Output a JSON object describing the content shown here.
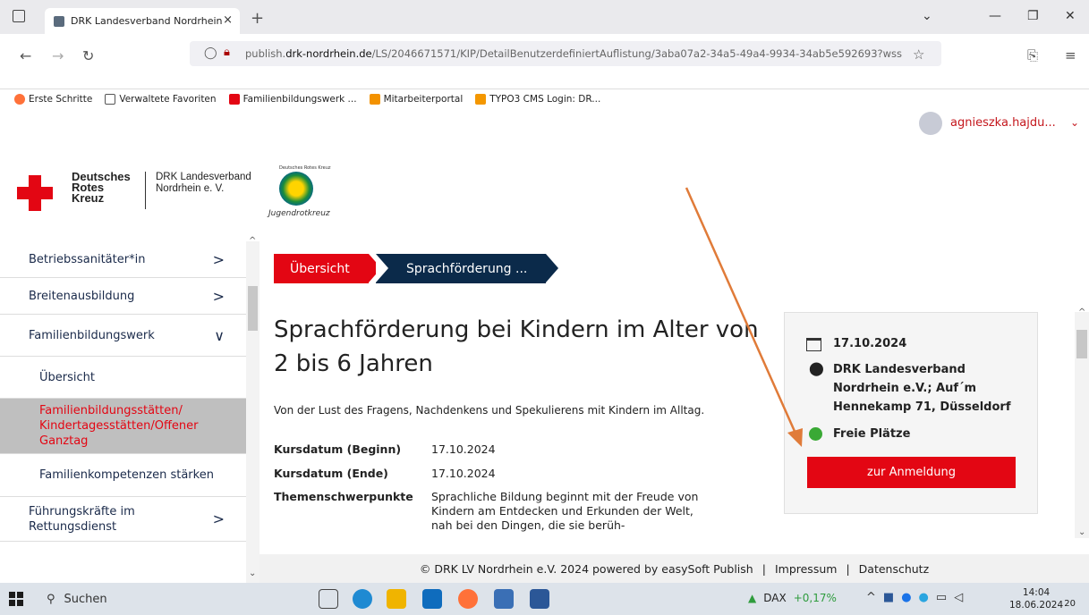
{
  "browser": {
    "tab_title": "DRK Landesverband Nordrhein",
    "tab_close": "×",
    "new_tab": "+",
    "url_domain_prefix": "publish.",
    "url_domain": "drk-nordrhein.de",
    "url_path": "/LS/2046671571/KIP/DetailBenutzerdefiniertAuflistung/3aba07a2-34a5-49a4-9934-34ab5e592693?wss",
    "bookmarks": [
      "Erste Schritte",
      "Verwaltete Favoriten",
      "Familienbildungswerk ...",
      "Mitarbeiterportal",
      "TYPO3 CMS Login: DR..."
    ]
  },
  "user": {
    "name": "agnieszka.hajdu..."
  },
  "logo": {
    "org_name": "Deutsches Rotes Kreuz",
    "org_line1": "Deutsches",
    "org_line2": "Rotes",
    "org_line3": "Kreuz",
    "branch_line1": "DRK Landesverband",
    "branch_line2": "Nordrhein e. V.",
    "jrk_top": "Deutsches Rotes Kreuz",
    "jrk_text": "Jugendrotkreuz"
  },
  "sidebar": {
    "items": [
      {
        "label": "Betriebssanitäter*in",
        "chevron": ">"
      },
      {
        "label": "Breitenausbildung",
        "chevron": ">"
      },
      {
        "label": "Familienbildungswerk",
        "chevron": "∨"
      },
      {
        "label": "Übersicht"
      },
      {
        "label": "Familienbildungsstätten/ Kindertagesstätten/Offener Ganztag"
      },
      {
        "label": "Familienkompetenzen stärken"
      },
      {
        "label": "Führungskräfte im Rettungsdienst",
        "chevron": ">"
      }
    ]
  },
  "breadcrumb": {
    "first": "Übersicht",
    "second": "Sprachförderung ..."
  },
  "course": {
    "title": "Sprachförderung bei Kindern im Alter von 2 bis 6 Jahren",
    "subtitle": "Von der Lust des Fragens, Nachdenkens und Spekulierens mit Kindern im Alltag.",
    "details": [
      {
        "key": "Kursdatum (Beginn)",
        "value": "17.10.2024"
      },
      {
        "key": "Kursdatum (Ende)",
        "value": "17.10.2024"
      },
      {
        "key": "Themenschwerpunkte",
        "value": "Sprachliche Bildung beginnt mit der Freude von Kindern am Entdecken und Erkunden der Welt, nah bei den Dingen, die sie berüh-"
      }
    ]
  },
  "infobox": {
    "date": "17.10.2024",
    "address": "DRK Landesverband Nordrhein e.V.; Auf´m Hennekamp 71, Düsseldorf",
    "availability": "Freie Plätze",
    "button": "zur Anmeldung"
  },
  "footer": {
    "copyright": "© DRK LV Nordrhein e.V. 2024 powered by easySoft Publish",
    "sep": "|",
    "impressum": "Impressum",
    "datenschutz": "Datenschutz"
  },
  "taskbar": {
    "search": "Suchen",
    "dax_label": "DAX",
    "dax_change": "+0,17%",
    "time": "14:04",
    "date": "18.06.2024",
    "notifications": "20"
  },
  "colors": {
    "drk_red": "#e30613",
    "navy": "#0b2a4a",
    "free_green": "#3aa935",
    "annotation_arrow": "#e07b39"
  }
}
